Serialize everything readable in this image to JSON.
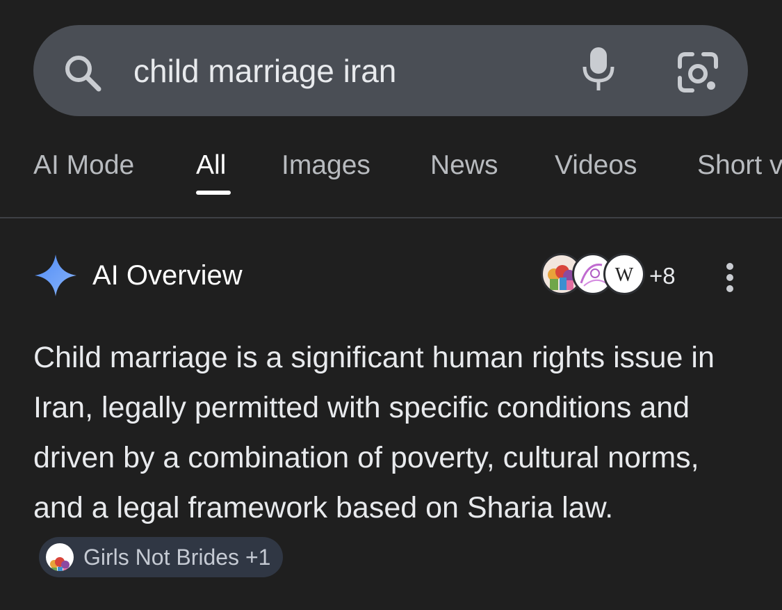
{
  "search": {
    "query": "child marriage iran"
  },
  "tabs": [
    {
      "label": "AI Mode"
    },
    {
      "label": "All"
    },
    {
      "label": "Images"
    },
    {
      "label": "News"
    },
    {
      "label": "Videos"
    },
    {
      "label": "Short v"
    }
  ],
  "active_tab": "All",
  "ai_overview": {
    "title": "AI Overview",
    "sources_more": "+8",
    "source_icons": [
      "girls-not-brides-logo",
      "source-logo",
      "wikipedia-logo"
    ],
    "summary": "Child marriage is a significant human rights issue in Iran, legally permitted with specific conditions and driven by a combination of poverty, cultural norms, and a legal framework based on Sharia law.",
    "citation_chip": "Girls Not Brides +1"
  },
  "colors": {
    "background": "#1f1f1f",
    "search_bar": "#4a4e55",
    "chip_background": "#303744",
    "ai_star": "#6ea8fe"
  }
}
